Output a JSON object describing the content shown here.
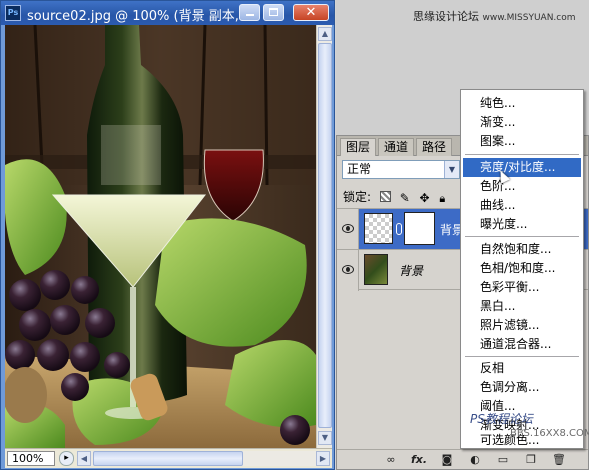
{
  "document": {
    "title": "source02.jpg @ 100% (背景 副本, ...",
    "app_icon": "Ps",
    "zoom": "100%"
  },
  "watermark": {
    "top_text": "思缘设计论坛",
    "top_url": "www.MISSYUAN.com",
    "bottom_text": "PS教程论坛",
    "bottom_url": "BBS.16XX8.COM"
  },
  "layers_panel": {
    "tabs": [
      "图层",
      "通道",
      "路径"
    ],
    "blend_mode": "正常",
    "lock_label": "锁定:",
    "layers": [
      {
        "name": "背景",
        "selected": true
      },
      {
        "name": "背景",
        "selected": false
      }
    ]
  },
  "adjust_menu": {
    "items": [
      {
        "label": "纯色..."
      },
      {
        "label": "渐变..."
      },
      {
        "label": "图案..."
      },
      {
        "label": "亮度/对比度...",
        "highlight": true
      },
      {
        "label": "色阶..."
      },
      {
        "label": "曲线..."
      },
      {
        "label": "曝光度..."
      },
      {
        "label": "自然饱和度..."
      },
      {
        "label": "色相/饱和度..."
      },
      {
        "label": "色彩平衡..."
      },
      {
        "label": "黑白..."
      },
      {
        "label": "照片滤镜..."
      },
      {
        "label": "通道混合器..."
      },
      {
        "label": "反相"
      },
      {
        "label": "色调分离..."
      },
      {
        "label": "阈值..."
      },
      {
        "label": "渐变映射..."
      },
      {
        "label": "可选颜色..."
      }
    ]
  },
  "colors": {
    "title_bar": "#2856a8",
    "selection": "#316ac5",
    "panel_bg": "#d6d3ce"
  },
  "icons": [
    "photoshop-app-icon",
    "minimize-icon",
    "maximize-icon",
    "close-icon",
    "eye-icon",
    "link-icon",
    "lock-transparent-icon",
    "lock-brush-icon",
    "lock-move-icon",
    "lock-all-icon",
    "link-layers-icon",
    "fx-icon",
    "mask-icon",
    "adjustment-layer-icon",
    "group-icon",
    "new-layer-icon",
    "trash-icon"
  ]
}
